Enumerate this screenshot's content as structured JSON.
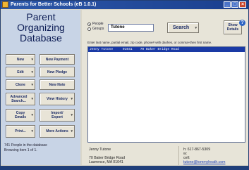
{
  "window": {
    "title": "Parents for Better Schools (eB 1.0.1)",
    "controls": {
      "minimize": "_",
      "maximize": "□",
      "close": "×"
    }
  },
  "app": {
    "title_line1": "Parent",
    "title_line2": "Organizing",
    "title_line3": "Database"
  },
  "left_buttons": {
    "new": "New",
    "new_payment": "New Payment",
    "edit": "Edit",
    "new_pledge": "New Pledge",
    "clone": "Clone",
    "new_note": "New Note",
    "advanced_search": "Advanced Search...",
    "view_history": "View History",
    "copy_emails": "Copy Emails",
    "import_export": "Import/ Export",
    "print": "Print...",
    "more_actions": "More Actions",
    "dropdown_glyph": "▾"
  },
  "status": {
    "line1": "741 People in the database",
    "line2": "Browsing item 1 of 1."
  },
  "search": {
    "mode_people": "People",
    "mode_groups": "Groups",
    "selected_mode": "People",
    "value": "Tutone",
    "button": "Search",
    "hint": "Enter last name, partial email, zip code, phone# with dashes, or comma+then first name."
  },
  "help": {
    "label": "Show Details",
    "icon": "?"
  },
  "results": [
    {
      "name": "Jenny Tutone",
      "zip": "01041",
      "address": "70 Baker Bridge Road"
    }
  ],
  "detail": {
    "name": "Jenny Tutone",
    "street": "70 Baker Bridge Road",
    "city_state_zip": "Lawrence, MA  01041",
    "phone": "h: 617-867-5309",
    "w": "w:",
    "cell": "cell:",
    "email": "tutone@tommyheath.com"
  },
  "colors": {
    "title_bar": "#2d58a9",
    "app_title": "#0d1d55",
    "selection": "#1a3aa5",
    "left_panel": "#c8d4e6"
  }
}
